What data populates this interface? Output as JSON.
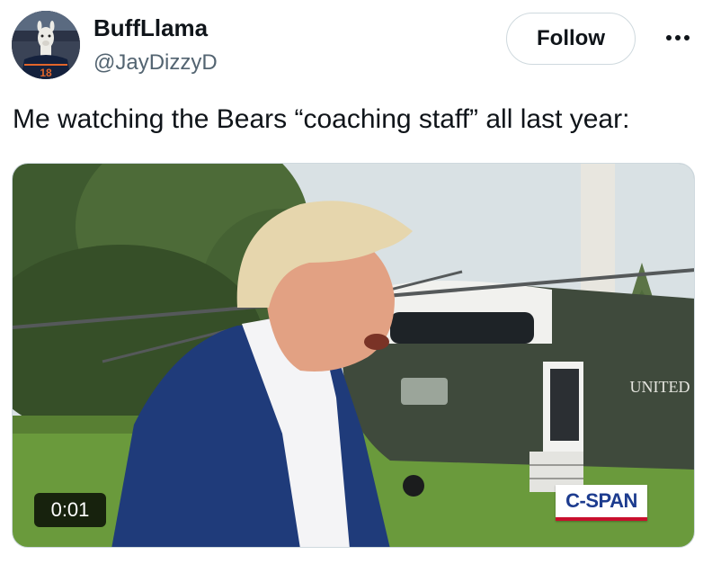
{
  "author": {
    "display_name": "BuffLlama",
    "handle": "@JayDizzyD",
    "avatar_jersey_number": "18"
  },
  "header": {
    "follow_label": "Follow",
    "more_icon": "more-icon"
  },
  "tweet": {
    "text": "Me watching the Bears “coaching staff” all last year:"
  },
  "media": {
    "type": "video",
    "elapsed_time": "0:01",
    "network_logo": "C-SPAN",
    "helicopter_marking": "UNITED"
  },
  "colors": {
    "text_primary": "#0f1419",
    "text_secondary": "#536471",
    "border": "#cfd9de",
    "cspan_blue": "#1d3c8f",
    "cspan_red": "#c8102e"
  }
}
